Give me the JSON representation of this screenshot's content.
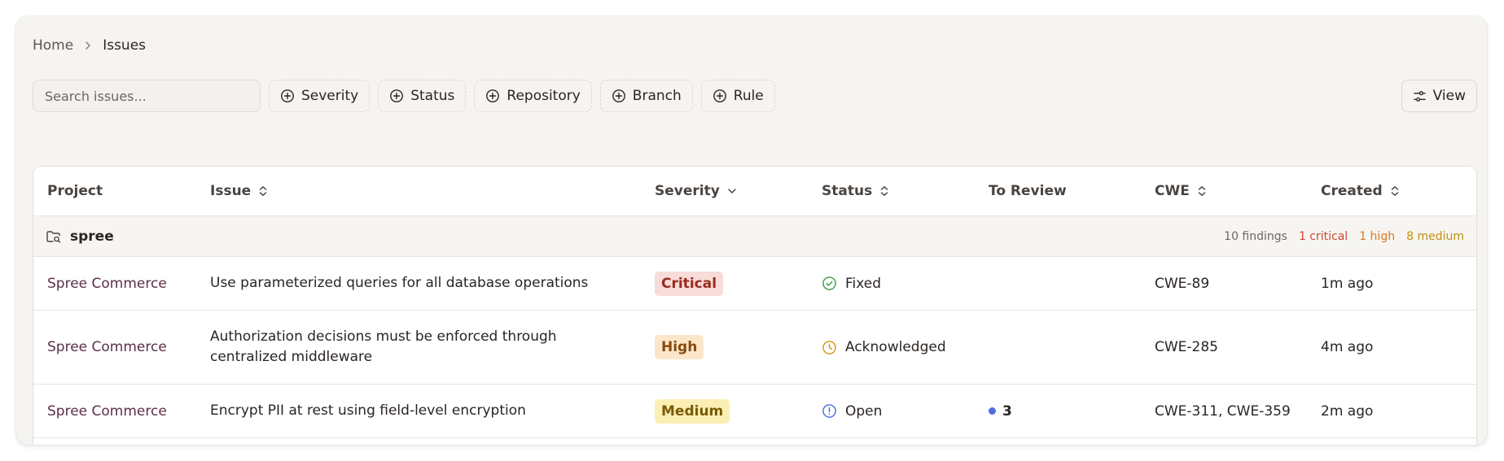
{
  "breadcrumb": {
    "home": "Home",
    "current": "Issues"
  },
  "toolbar": {
    "search_placeholder": "Search issues...",
    "filters": [
      "Severity",
      "Status",
      "Repository",
      "Branch",
      "Rule"
    ],
    "view_label": "View"
  },
  "table": {
    "headers": {
      "project": "Project",
      "issue": "Issue",
      "severity": "Severity",
      "status": "Status",
      "to_review": "To Review",
      "cwe": "CWE",
      "created": "Created"
    },
    "group": {
      "name": "spree",
      "findings": "10 findings",
      "critical": "1 critical",
      "high": "1 high",
      "medium": "8 medium"
    },
    "rows": [
      {
        "project": "Spree Commerce",
        "issue": "Use parameterized queries for all database operations",
        "severity": "Critical",
        "status": "Fixed",
        "to_review": "",
        "cwe": "CWE-89",
        "created": "1m ago"
      },
      {
        "project": "Spree Commerce",
        "issue": "Authorization decisions must be enforced through centralized middleware",
        "severity": "High",
        "status": "Acknowledged",
        "to_review": "",
        "cwe": "CWE-285",
        "created": "4m ago"
      },
      {
        "project": "Spree Commerce",
        "issue": "Encrypt PII at rest using field-level encryption",
        "severity": "Medium",
        "status": "Open",
        "to_review": "3",
        "cwe": "CWE-311, CWE-359",
        "created": "2m ago"
      }
    ]
  },
  "colors": {
    "critical": "#d0462f",
    "high": "#d97a1a",
    "medium": "#c2900a",
    "fixed": "#3f9a4a",
    "acknowledged": "#d6960f",
    "open": "#4f6de0"
  }
}
